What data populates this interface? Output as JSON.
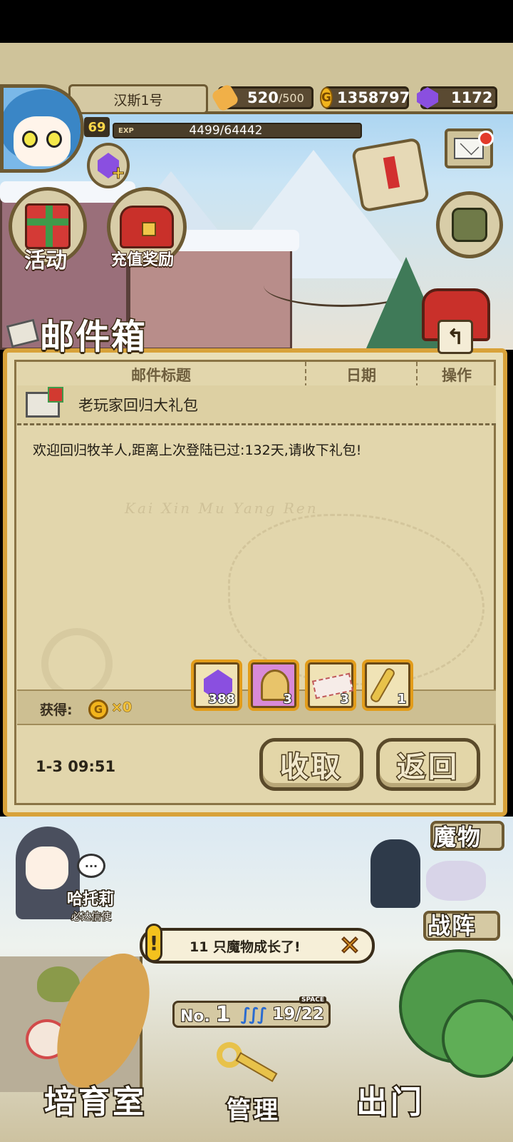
{
  "player": {
    "name": "汉斯1号",
    "level": "69",
    "exp_label": "EXP",
    "exp": "4499/64442"
  },
  "resources": {
    "stamina": "520",
    "stamina_max": "/500",
    "gold": "1358797",
    "gems": "1172"
  },
  "menu": {
    "activity": "活动",
    "recharge_reward": "充值奖励"
  },
  "mailbox": {
    "title": "邮件箱",
    "back_icon": "↰",
    "columns": [
      "邮件标题",
      "日期",
      "操作"
    ],
    "subject": "老玩家回归大礼包",
    "body": "欢迎回归牧羊人,距离上次登陆已过:132天,请收下礼包!",
    "watermark": "Kai Xin Mu Yang Ren",
    "reward_label": "获得:",
    "coin_symbol": "G",
    "coin_count": "×0",
    "items": [
      {
        "name": "purple-gem",
        "count": "388"
      },
      {
        "name": "golden-harp",
        "count": "3"
      },
      {
        "name": "ticket",
        "count": "3"
      },
      {
        "name": "golden-key",
        "count": "1"
      }
    ],
    "date": "1-3 09:51",
    "claim_label": "收取",
    "return_label": "返回"
  },
  "bottom": {
    "npc_name": "哈托莉",
    "npc_title": "必达信使",
    "npc_speech": "···",
    "monster_label": "魔物",
    "formation_label": "战阵",
    "notice_icon": "!",
    "notice": "11 只魔物成长了!",
    "notice_close": "✕",
    "rank_prefix": "No.",
    "rank": "1",
    "capacity_tag": "SPACE",
    "capacity": "19/22",
    "nav": {
      "nursery": "培育室",
      "manage": "管理",
      "exit": "出门"
    }
  },
  "colors": {
    "panel_border": "#d8a23a",
    "parchment": "#e2d6ac",
    "frame_brown": "#6d5a33",
    "gem_purple": "#8a4fe0",
    "gold": "#f2b41c"
  }
}
